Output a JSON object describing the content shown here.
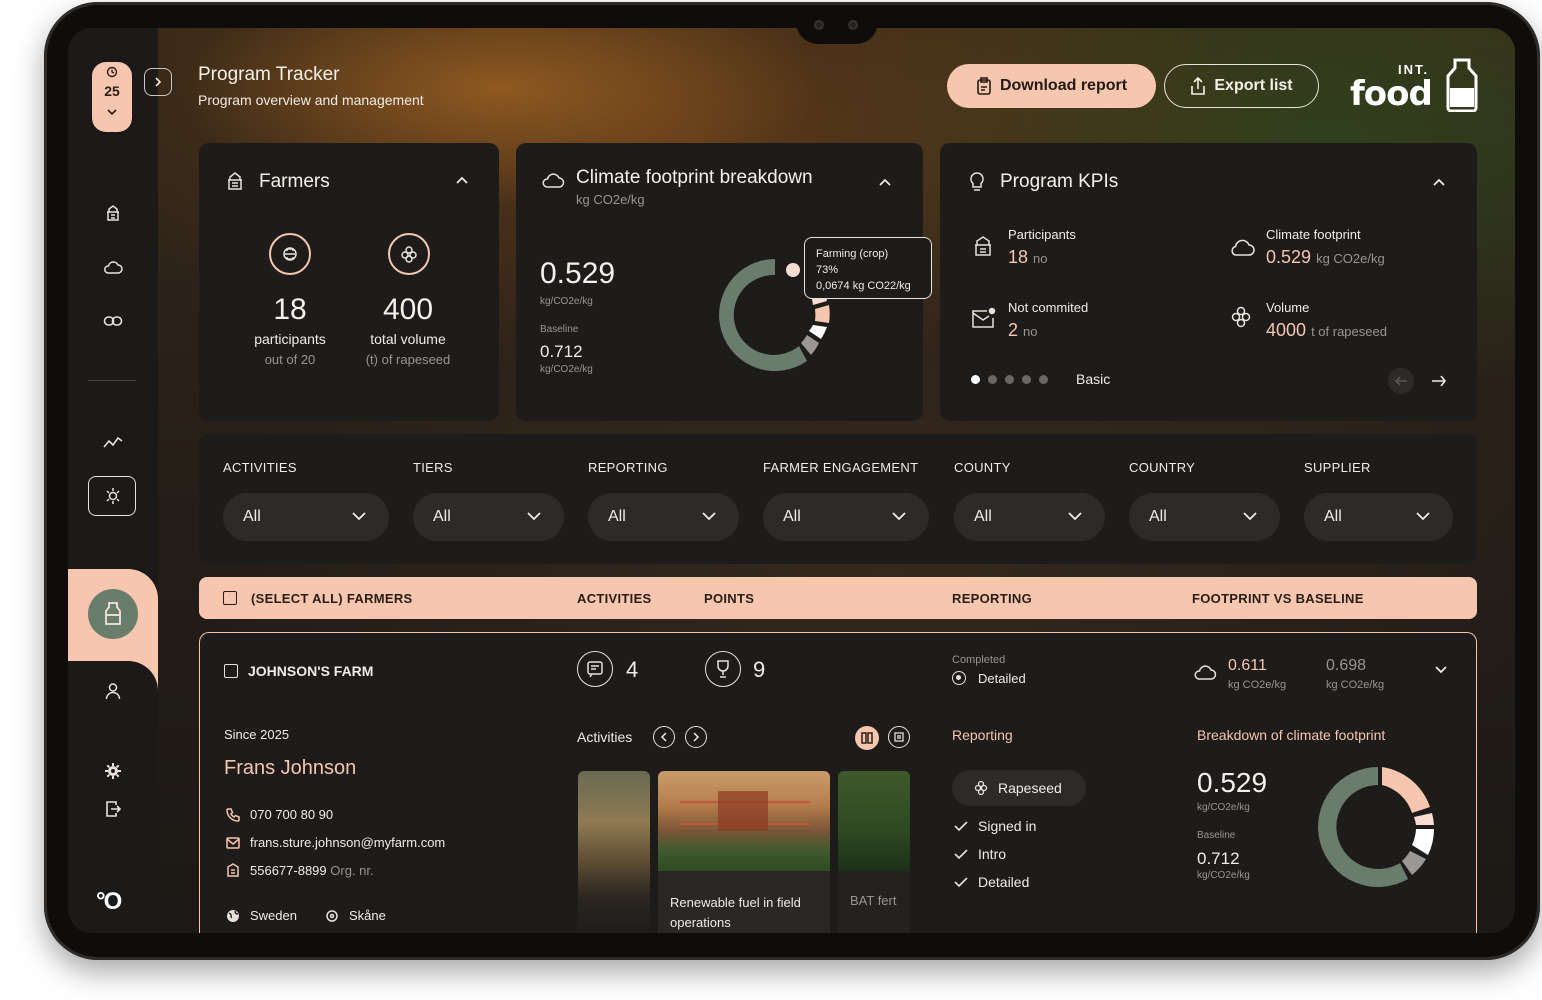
{
  "sidebar": {
    "date_day": "25",
    "nav_items": [
      "farmers-icon",
      "climate-icon",
      "link-icon",
      "analytics-icon",
      "farmer-group-icon",
      "product-icon",
      "user-icon",
      "settings-icon",
      "logout-icon"
    ],
    "bottom_logo": "°O"
  },
  "header": {
    "title": "Program Tracker",
    "subtitle": "Program overview and management",
    "download_label": "Download report",
    "export_label": "Export list",
    "brand_top": "INT.",
    "brand_main": "food"
  },
  "farmers_card": {
    "title": "Farmers",
    "participants_value": "18",
    "participants_label": "participants",
    "participants_sub": "out of 20",
    "volume_value": "400",
    "volume_label": "total volume",
    "volume_sub": "(t) of rapeseed"
  },
  "climate_card": {
    "title": "Climate footprint breakdown",
    "unit": "kg CO2e/kg",
    "value": "0.529",
    "value_unit": "kg/CO2e/kg",
    "baseline_label": "Baseline",
    "baseline_value": "0.712",
    "baseline_unit": "kg/CO2e/kg",
    "tooltip_title": "Farming (crop)",
    "tooltip_pct": "73%",
    "tooltip_val": "0,0674 kg CO22/kg"
  },
  "kpi_card": {
    "title": "Program KPIs",
    "participants_label": "Participants",
    "participants_value": "18",
    "participants_unit": "no",
    "climate_label": "Climate footprint",
    "climate_value": "0.529",
    "climate_unit": "kg CO2e/kg",
    "notcommitted_label": "Not commited",
    "notcommitted_value": "2",
    "notcommitted_unit": "no",
    "volume_label": "Volume",
    "volume_value": "4000",
    "volume_unit": "t of rapeseed",
    "page_label": "Basic",
    "dots_total": 5,
    "dots_active": 1
  },
  "filters": [
    {
      "label": "ACTIVITIES",
      "value": "All"
    },
    {
      "label": "TIERS",
      "value": "All"
    },
    {
      "label": "REPORTING",
      "value": "All"
    },
    {
      "label": "FARMER ENGAGEMENT",
      "value": "All"
    },
    {
      "label": "COUNTY",
      "value": "All"
    },
    {
      "label": "COUNTRY",
      "value": "All"
    },
    {
      "label": "SUPPLIER",
      "value": "All"
    }
  ],
  "table_header": {
    "select_all": "(SELECT ALL) FARMERS",
    "activities": "ACTIVITIES",
    "points": "POINTS",
    "reporting": "REPORTING",
    "footprint": "FOOTPRINT VS BASELINE"
  },
  "farm_row": {
    "name": "JOHNSON'S FARM",
    "activities_count": "4",
    "points_count": "9",
    "reporting_status": "Completed",
    "reporting_level": "Detailed",
    "footprint_value": "0.611",
    "footprint_unit": "kg CO2e/kg",
    "baseline_value": "0.698",
    "baseline_unit": "kg CO2e/kg",
    "since": "Since 2025",
    "farmer_name": "Frans Johnson",
    "phone": "070 700 80 90",
    "email": "frans.sture.johnson@myfarm.com",
    "org_number": "556677-8899",
    "org_label": "Org. nr.",
    "country": "Sweden",
    "county": "Skåne",
    "activities_title": "Activities",
    "activity_cards": [
      {
        "caption": "Renewable fuel in field operations"
      },
      {
        "caption": "BAT fert"
      }
    ],
    "reporting_title": "Reporting",
    "crop_tag": "Rapeseed",
    "reporting_items": [
      "Signed in",
      "Intro",
      "Detailed"
    ],
    "breakdown_title": "Breakdown of climate footprint",
    "breakdown_value": "0.529",
    "breakdown_unit": "kg/CO2e/kg",
    "breakdown_baseline_label": "Baseline",
    "breakdown_baseline_value": "0.712",
    "breakdown_baseline_unit": "kg/CO2e/kg"
  },
  "colors": {
    "accent": "#f6c6ae",
    "donut_main": "#6a7d6c",
    "donut_grey": "#9a9794",
    "donut_light": "#f9ddd0",
    "card_bg": "#1d1c1b"
  }
}
